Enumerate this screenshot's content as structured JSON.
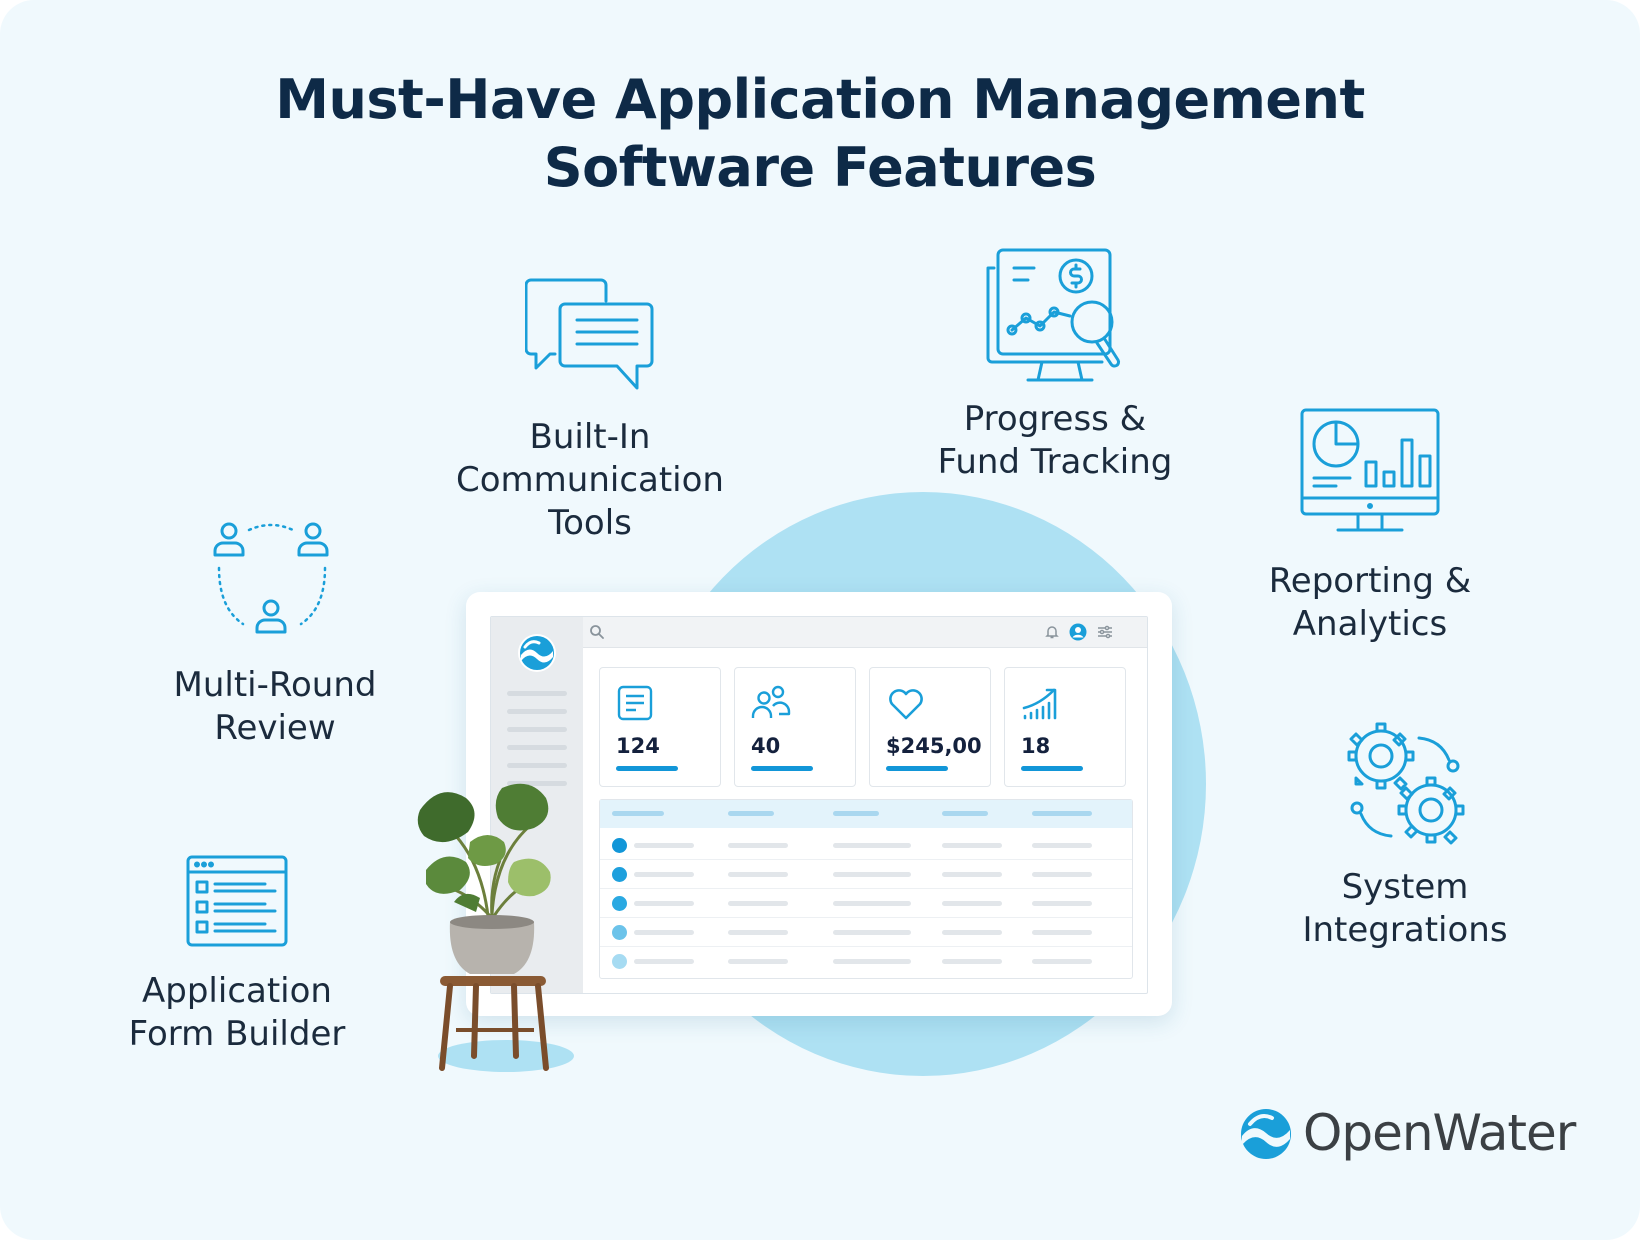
{
  "title": {
    "line1": "Must-Have Application Management",
    "line2": "Software Features"
  },
  "features": {
    "communication": {
      "icon": "chat-bubbles-icon",
      "lines": [
        "Built-In",
        "Communication",
        "Tools"
      ]
    },
    "progress": {
      "icon": "monitor-dollar-magnifier-icon",
      "lines": [
        "Progress &",
        "Fund Tracking"
      ]
    },
    "reporting": {
      "icon": "monitor-analytics-icon",
      "lines": [
        "Reporting &",
        "Analytics"
      ]
    },
    "review": {
      "icon": "people-cycle-icon",
      "lines": [
        "Multi-Round",
        "Review"
      ]
    },
    "integrations": {
      "icon": "gears-icon",
      "lines": [
        "System",
        "Integrations"
      ]
    },
    "formbuilder": {
      "icon": "form-window-icon",
      "lines": [
        "Application",
        "Form Builder"
      ]
    }
  },
  "dashboard": {
    "stats": [
      {
        "icon": "document-icon",
        "value": "124"
      },
      {
        "icon": "users-icon",
        "value": "40"
      },
      {
        "icon": "heart-icon",
        "value": "$245,00"
      },
      {
        "icon": "trending-chart-icon",
        "value": "18"
      }
    ]
  },
  "brand": {
    "name": "OpenWater"
  },
  "colors": {
    "background": "#f0f9fd",
    "accent": "#1a9fd9",
    "title": "#0e2a47",
    "blob": "#aee1f3"
  }
}
